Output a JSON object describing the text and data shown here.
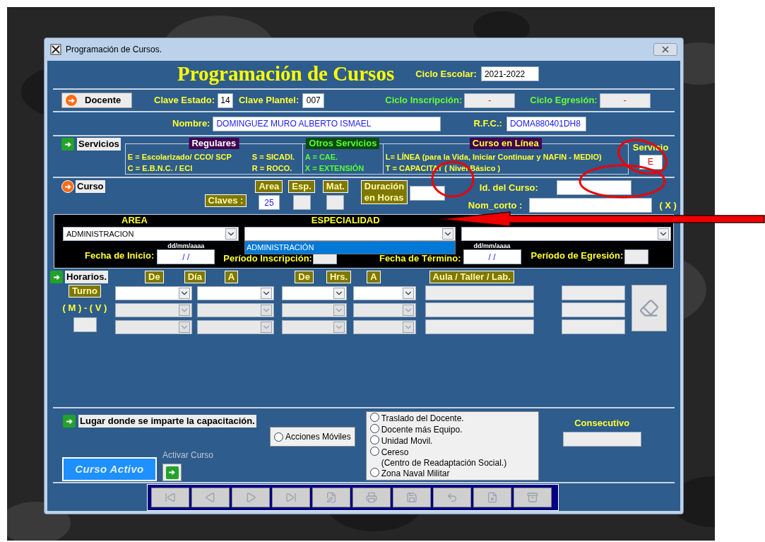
{
  "window": {
    "title": "Programación de Cursos."
  },
  "header": {
    "title": "Programación de Cursos",
    "ciclo_escolar": {
      "label": "Ciclo Escolar:",
      "value": "2021-2022"
    }
  },
  "docente": {
    "button": "Docente",
    "clave_estado": {
      "label": "Clave Estado:",
      "value": "14"
    },
    "clave_plantel": {
      "label": "Clave Plantel:",
      "value": "007"
    },
    "ciclo_inscripcion": {
      "label": "Ciclo Inscripción:",
      "value": "-"
    },
    "ciclo_egresion": {
      "label": "Ciclo Egresión:",
      "value": "-"
    }
  },
  "persona": {
    "nombre": {
      "label": "Nombre:",
      "value": "DOMINGUEZ MURO ALBERTO ISMAEL"
    },
    "rfc": {
      "label": "R.F.C.:",
      "value": "DOMA880401DH8"
    }
  },
  "servicios": {
    "button": "Servicios",
    "groups": [
      {
        "kind": "regulares",
        "title": "Regulares",
        "lines": [
          [
            "E = Escolarizado/ CCO/ SCP",
            "S = SICADI."
          ],
          [
            "C = E.B.N.C. / ECI",
            "R = ROCO."
          ]
        ]
      },
      {
        "kind": "otros",
        "title": "Otros Servicios",
        "lines": [
          [
            "A = CAE."
          ],
          [
            "X = EXTENSIÓN"
          ]
        ]
      },
      {
        "kind": "linea",
        "title": "Curso en Línea",
        "lines": [
          [
            "L= LÍNEA (para la Vida, Iniciar Continuar y NAFIN - MEDIO)"
          ],
          [
            "T = CAPACITAT ( Nivel Básico )"
          ]
        ]
      }
    ],
    "servicio": {
      "label": "Servicio",
      "value": "E"
    }
  },
  "curso": {
    "button": "Curso",
    "claves_label": "Claves :",
    "area": {
      "label": "Area",
      "value": "25"
    },
    "esp": {
      "label": "Esp."
    },
    "mat": {
      "label": "Mat."
    },
    "duracion": {
      "label": "Duración en Horas"
    },
    "id_curso": {
      "label": "Id. del Curso:"
    },
    "nom_corto": {
      "label": "Nom_corto :",
      "suffix": "( X )"
    }
  },
  "seleccion": {
    "area": {
      "label": "AREA",
      "value": "ADMINISTRACION"
    },
    "especialidad": {
      "label": "ESPECIALIDAD",
      "expanded": true,
      "options": [
        {
          "label": "ADMINISTRACIÓN",
          "selected": true
        }
      ]
    },
    "fecha_inicio": {
      "hint": "dd/mm/aaaa",
      "label": "Fecha de Inicio:",
      "value": "/ /"
    },
    "periodo_inscripcion": {
      "label": "Período Inscripción:"
    },
    "fecha_termino": {
      "hint": "dd/mm/aaaa",
      "label": "Fecha de Término:",
      "value": "/ /"
    },
    "periodo_egresion": {
      "label": "Período de Egresión:"
    }
  },
  "horarios": {
    "button": "Horarios.",
    "turno": "Turno",
    "turno_hint": "( M ) - ( V )",
    "headers": [
      "De",
      "Día",
      "A",
      "De",
      "Hrs.",
      "A",
      "Aula / Taller / Lab."
    ],
    "rows": [
      {
        "disabled": false
      },
      {
        "disabled": true
      },
      {
        "disabled": true
      }
    ]
  },
  "lugar": {
    "label": "Lugar donde se imparte la capacitación.",
    "acciones": {
      "label": "Acciones Móviles",
      "selected": false
    },
    "options": [
      {
        "label": "Traslado del Docente.",
        "selected": false
      },
      {
        "label": "Docente más Equipo.",
        "selected": false
      },
      {
        "label": "Unidad Movil.",
        "selected": false
      },
      {
        "label": "Cereso",
        "note": "(Centro de Readaptación Social.)",
        "selected": false
      },
      {
        "label": "Zona Naval Militar",
        "selected": false
      }
    ],
    "consecutivo": "Consecutivo"
  },
  "activar": {
    "label": "Activar Curso",
    "button": "Curso Activo"
  },
  "nav": [
    {
      "kind": "first",
      "disabled": true
    },
    {
      "kind": "previous",
      "disabled": true
    },
    {
      "kind": "next",
      "disabled": true
    },
    {
      "kind": "last",
      "disabled": true
    },
    {
      "kind": "edit",
      "disabled": true
    },
    {
      "kind": "print",
      "disabled": true
    },
    {
      "kind": "save",
      "disabled": true
    },
    {
      "kind": "undo",
      "disabled": true
    },
    {
      "kind": "delete",
      "disabled": true
    },
    {
      "kind": "new",
      "disabled": true
    }
  ]
}
